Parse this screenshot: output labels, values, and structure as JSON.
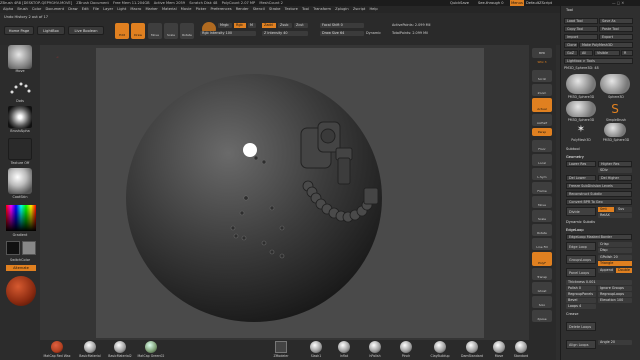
{
  "window": {
    "title_parts": [
      "ZBrush 4R8 [DESKTOP-QEP9GHV-MOVE]",
      "ZBrush Document",
      "Free Mem 11.204GB",
      "Active Mem 2059",
      "Scratch Disk 48",
      "PolyCount 2.07 MP",
      "MeshCount 2"
    ],
    "quicksave": "QuickSave",
    "see_through": "See-through 0",
    "menus_btn": "Menus",
    "default_script": "DefaultZScript"
  },
  "menus": [
    "Alpha",
    "Brush",
    "Color",
    "Document",
    "Draw",
    "Edit",
    "File",
    "Layer",
    "Light",
    "Macro",
    "Marker",
    "Material",
    "Movie",
    "Picker",
    "Preferences",
    "Render",
    "Stencil",
    "Stroke",
    "Texture",
    "Tool",
    "Transform",
    "Zplugin",
    "Zscript",
    "Help"
  ],
  "undo_history": "Undo History 2 out of 17",
  "shelf": {
    "home": "Home Page",
    "lightbox": "LightBox",
    "live_boolean": "Live Boolean",
    "edit": "Edit",
    "draw": "Draw",
    "move": "Move",
    "scale": "Scale",
    "rotate": "Rotate",
    "mrgb": "Mrgb",
    "rgb": "Rgb",
    "m": "M",
    "rgb_intensity": "Rgb Intensity 100",
    "zadd": "Zadd",
    "zsub": "Zsub",
    "zcut": "Zcut",
    "z_intensity": "Z Intensity 40",
    "focal_shift": "Focal Shift 0",
    "draw_size": "Draw Size 64",
    "dynamic": "Dynamic",
    "active_points": "ActivePoints: 2.099 Mil",
    "total_points": "TotalPoints: 2.099 Mil"
  },
  "left": {
    "brush_label": "Move",
    "stroke_label": "Dots",
    "alpha_label": "BrushAlpha",
    "texture_label": "Texture Off",
    "material_label": "CoatSkin",
    "gradient_label": "Gradient",
    "switch_color": "SwitchColor",
    "alternate": "Alternate",
    "colors": {
      "main": "#ffffff",
      "secondary": "#000000",
      "material": "#a33a1a"
    }
  },
  "right_strip": [
    "BPR",
    "SPix 3",
    "Scroll",
    "Zoom",
    "Actual",
    "AAHalf",
    "Persp",
    "Floor",
    "Local",
    "L.Sym",
    "Frame",
    "Move",
    "Scale",
    "Rotate",
    "Line Fill",
    "PolyF",
    "Transp",
    "Ghost",
    "Solo",
    "Xpose"
  ],
  "tool": {
    "title": "Tool",
    "buttons": [
      "Load Tool",
      "Save As",
      "Copy Tool",
      "Paste Tool",
      "Import",
      "Export",
      "Clone",
      "Make PolyMesh3D",
      "GoZ",
      "All",
      "Visible",
      "R",
      "Lightbox > Tools"
    ],
    "current": "PM3D_Sphere3D: 48",
    "thumbs": [
      "PM3D_Sphere3D",
      "Sphere3D",
      "PM3D_Sphere3D",
      "SimpleBrush",
      "PolyMesh3D",
      "PM3D_Sphere3D"
    ],
    "subtool": "Subtool",
    "geometry": "Geometry",
    "lower_res": "Lower Res",
    "higher_res": "Higher Res",
    "sdiv": "SDiv",
    "del_lower": "Del Lower",
    "del_higher": "Del Higher",
    "freeze": "Freeze SubDivision Levels",
    "reconstruct": "Reconstruct Subdiv",
    "convert_bpr": "Convert BPR To Geo",
    "divide": "Divide",
    "smt": "Smt",
    "suv": "Suv",
    "relax": "RelAX",
    "dynamic_subdiv": "Dynamic Subdiv",
    "edgeloop": "EdgeLoop",
    "edgeloop_masked": "EdgeLoop Masked Border",
    "edge_loop": "Edge Loop",
    "crisp": "Crisp",
    "disp": "Disp",
    "groups_loops": "GroupsLoops",
    "gpolish": "GPolish 20",
    "triangle": "Triangle",
    "panel_loops": "Panel Loops",
    "append": "Append",
    "double": "Double",
    "thickness": "Thickness 0.001",
    "polish": "Polish 0",
    "bevel": "Bevel",
    "elevation": "Elevation 100",
    "loops": "Loops 4",
    "ignore_groups": "Ignore Groups",
    "regroup_panels": "RegroupPanels",
    "regroup_loops": "RegroupLoops",
    "crease": "Crease",
    "delete_loops": "Delete Loops",
    "align_loops": "Align Loops",
    "angle": "Angle 20"
  },
  "materials": [
    "MatCap Red Wax",
    "BasicMaterial",
    "BasicMaterial2",
    "MatCap Green02",
    "ZModeler",
    "Slash1",
    "Inflat",
    "hPolish",
    "Pinch",
    "ClayBuildup",
    "DamStandard",
    "Move",
    "Standard"
  ],
  "materials_colors": {
    "red": "#b04020",
    "grey": "#9a9a9a",
    "green": "#7a9a70"
  }
}
